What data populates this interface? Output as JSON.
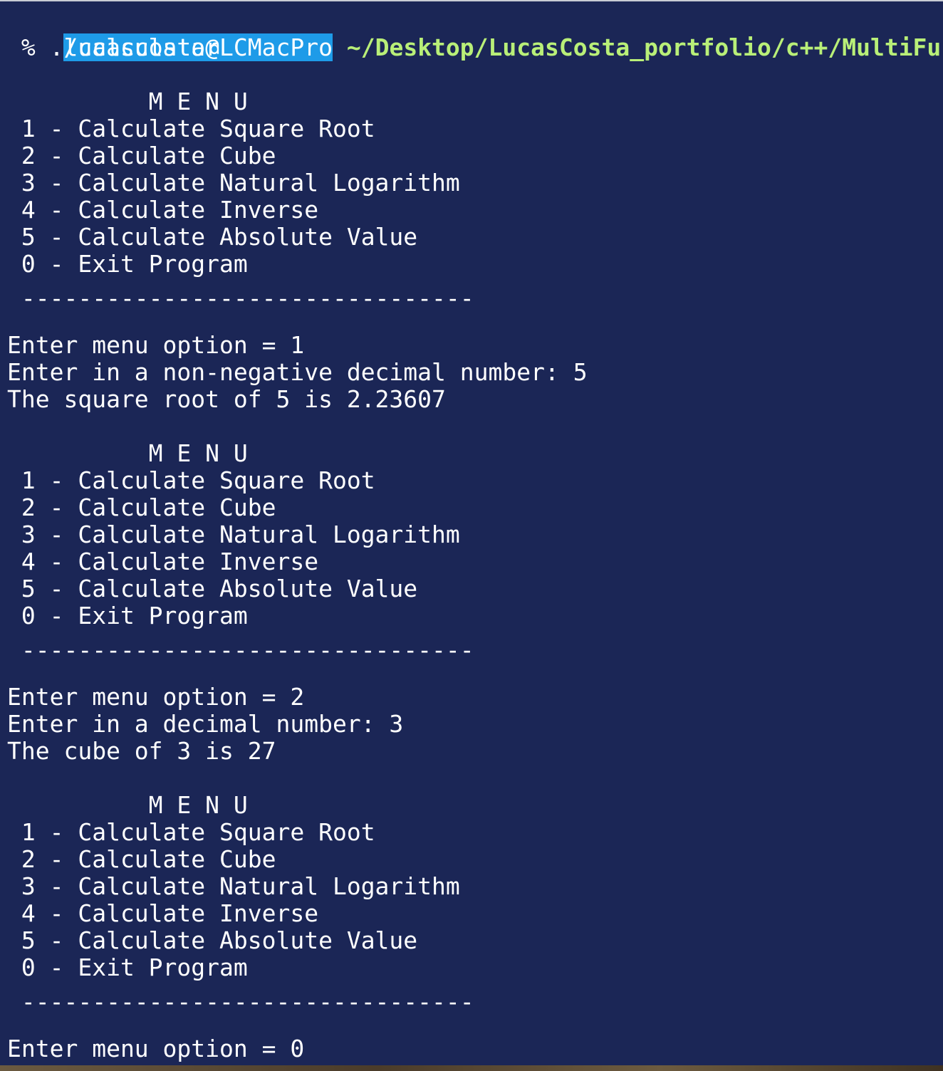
{
  "prompt": {
    "user_host": "lucascosta@LCMacPro",
    "path": " ~/Desktop/LucasCosta_portfolio/c++/MultiFuncti",
    "command": " % ./calculator"
  },
  "menu": {
    "title": "          M E N U",
    "items": [
      " 1 - Calculate Square Root",
      " 2 - Calculate Cube",
      " 3 - Calculate Natural Logarithm",
      " 4 - Calculate Inverse",
      " 5 - Calculate Absolute Value",
      " 0 - Exit Program"
    ],
    "separator": " --------------------------------"
  },
  "sessions": [
    {
      "option_line": "Enter menu option = 1",
      "input_line": "Enter in a non-negative decimal number: 5",
      "result_line": "The square root of 5 is 2.23607"
    },
    {
      "option_line": "Enter menu option = 2",
      "input_line": "Enter in a decimal number: 3",
      "result_line": "The cube of 3 is 27"
    }
  ],
  "final_option_line": "Enter menu option = 0"
}
